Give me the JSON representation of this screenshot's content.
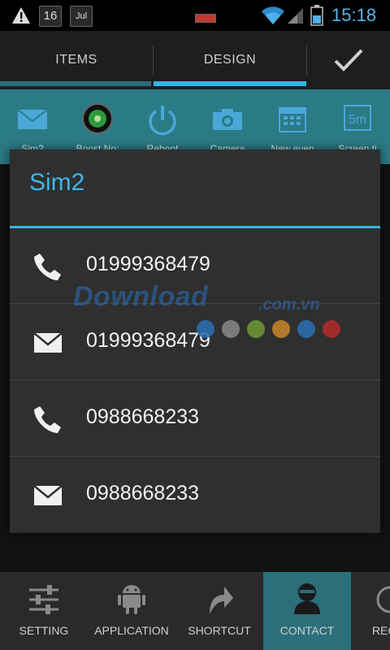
{
  "status_bar": {
    "notif_warning_icon": "warning-icon",
    "calendar1_day": "16",
    "calendar2_month": "Jul",
    "time": "15:18",
    "colors": {
      "time": "#5ab4e6"
    }
  },
  "tabs": [
    {
      "label": "ITEMS",
      "active": false
    },
    {
      "label": "DESIGN",
      "active": true
    }
  ],
  "confirm_icon": "checkmark-icon",
  "quick_toggles": [
    {
      "label": "Sim2",
      "icon": "envelope-icon"
    },
    {
      "label": "Boost No:",
      "icon": "boost-icon"
    },
    {
      "label": "Reboot",
      "icon": "power-icon"
    },
    {
      "label": "Camera",
      "icon": "camera-icon"
    },
    {
      "label": "New even",
      "icon": "calendar-icon"
    },
    {
      "label": "Screen ti",
      "icon": "screen-timeout-icon"
    }
  ],
  "dialog": {
    "title": "Sim2",
    "items": [
      {
        "type": "call",
        "icon": "phone-icon",
        "value": "01999368479"
      },
      {
        "type": "sms",
        "icon": "envelope-icon",
        "value": "01999368479"
      },
      {
        "type": "call",
        "icon": "phone-icon",
        "value": "0988668233"
      },
      {
        "type": "sms",
        "icon": "envelope-icon",
        "value": "0988668233"
      }
    ]
  },
  "watermark": {
    "main": "Download",
    "suffix": ".com.vn",
    "dot_colors": [
      "#2b6fb3",
      "#888888",
      "#6d9a3a",
      "#c9862a",
      "#2b6fb3",
      "#b52a2a"
    ]
  },
  "bottom_tabs": [
    {
      "label": "SETTING",
      "icon": "sliders-icon",
      "active": false
    },
    {
      "label": "APPLICATION",
      "icon": "android-icon",
      "active": false
    },
    {
      "label": "SHORTCUT",
      "icon": "shortcut-arrow-icon",
      "active": false
    },
    {
      "label": "CONTACT",
      "icon": "contact-icon",
      "active": true
    },
    {
      "label": "REC",
      "icon": "recent-icon",
      "active": false
    }
  ],
  "colors": {
    "accent": "#33b5e5",
    "toggle_bar": "#2b7b86",
    "bottom_active": "#2b6f7a"
  }
}
